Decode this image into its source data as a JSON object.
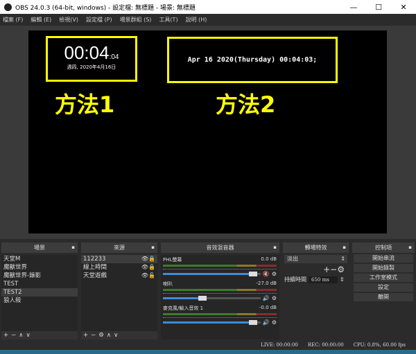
{
  "window": {
    "title": "OBS 24.0.3 (64-bit, windows) - 設定檔: 無標題 - 場景: 無標題",
    "min": "—",
    "max": "☐",
    "close": "✕"
  },
  "menu": [
    "檔案 (F)",
    "編輯 (E)",
    "檢視(V)",
    "設定檔 (P)",
    "場景群組 (S)",
    "工具(T)",
    "說明 (H)"
  ],
  "preview": {
    "clock_main": "00:04",
    "clock_sec": ":04",
    "clock_date": "週四, 2020年4月16日",
    "method2_text": "Apr 16 2020(Thursday) 00:04:03;",
    "label1": "方法1",
    "label2": "方法2"
  },
  "scenes": {
    "title": "場景",
    "items": [
      "天堂M",
      "魔獸世界",
      "魔獸世界-錄影",
      "TEST",
      "TEST2",
      "狼人殺"
    ],
    "selected": 4,
    "toolbar": "+−∧∨"
  },
  "sources": {
    "title": "來源",
    "items": [
      "112233",
      "線上時間",
      "天堂遊戲"
    ],
    "toolbar": "+−⚙∧∨"
  },
  "mixer": {
    "title": "音效混音器",
    "channels": [
      {
        "name": "PHL螢幕",
        "db": "0.0 dB",
        "level": 1.0,
        "muted": true
      },
      {
        "name": "喇叭",
        "db": "-27.0 dB",
        "level": 0.4,
        "muted": false
      },
      {
        "name": "麥克風/輸入音效 1",
        "db": "-0.0 dB",
        "level": 1.0,
        "muted": false
      }
    ]
  },
  "transitions": {
    "title": "轉場特效",
    "selected": "淡出",
    "duration_label": "持續時間",
    "duration": "650 ms"
  },
  "controls": {
    "title": "控制項",
    "buttons": [
      "開始串流",
      "開始錄製",
      "工作室模式",
      "設定",
      "離開"
    ]
  },
  "status": {
    "live": "LIVE: 00:00:00",
    "rec": "REC: 00:00:00",
    "cpu": "CPU: 0.8%, 60.00 fps"
  }
}
